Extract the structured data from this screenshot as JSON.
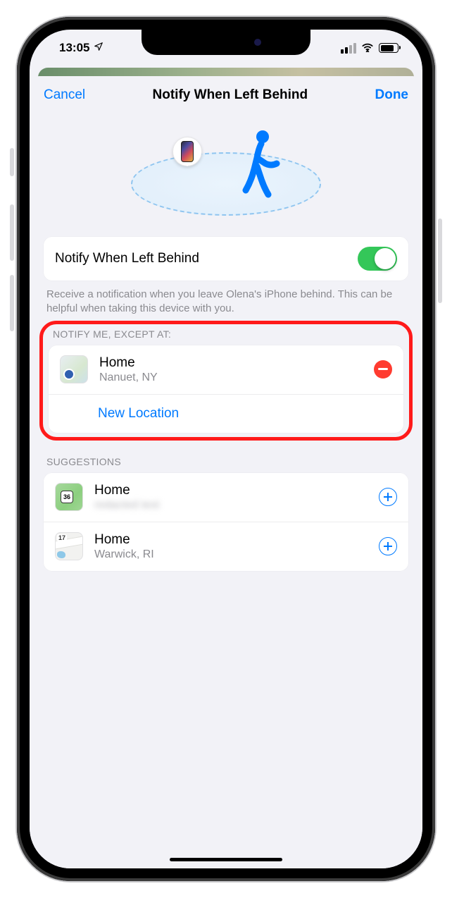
{
  "statusbar": {
    "time": "13:05"
  },
  "nav": {
    "cancel": "Cancel",
    "title": "Notify When Left Behind",
    "done": "Done"
  },
  "toggle": {
    "label": "Notify When Left Behind",
    "on": true
  },
  "description": "Receive a notification when you leave Olena's iPhone behind. This can be helpful when taking this device with you.",
  "except": {
    "header": "Notify Me, Except At:",
    "items": [
      {
        "title": "Home",
        "subtitle": "Nanuet, NY"
      }
    ],
    "new_location": "New Location"
  },
  "suggestions": {
    "header": "Suggestions",
    "items": [
      {
        "title": "Home",
        "subtitle": "",
        "redacted": true,
        "thumb": "green",
        "badge": "36"
      },
      {
        "title": "Home",
        "subtitle": "Warwick, RI",
        "thumb": "road",
        "badge": "17"
      }
    ]
  }
}
